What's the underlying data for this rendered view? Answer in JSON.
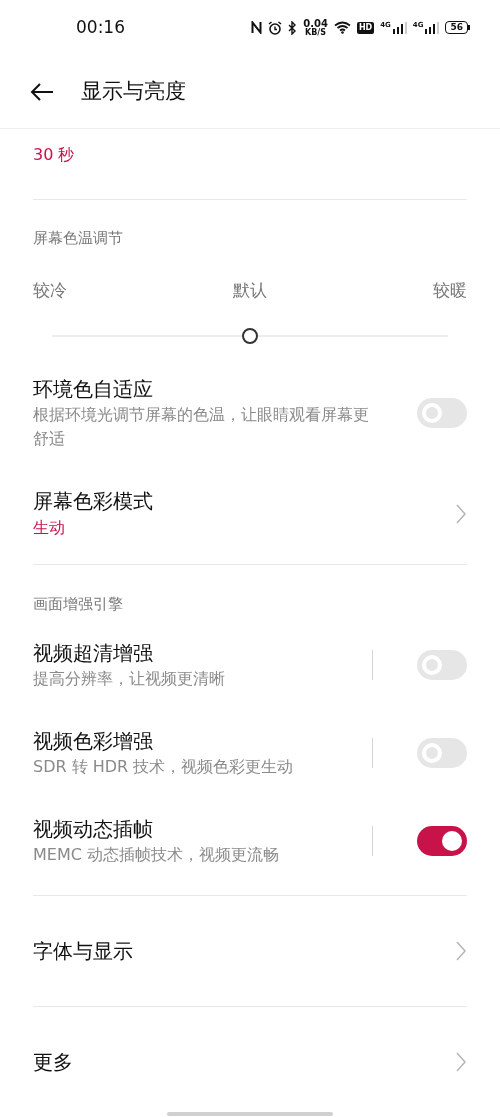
{
  "status_bar": {
    "time": "00:16",
    "speed_value": "0.04",
    "speed_unit": "KB/S",
    "hd": "HD",
    "networks": [
      "4G",
      "4G"
    ],
    "battery": "56"
  },
  "header": {
    "title": "显示与亮度"
  },
  "screen_off": {
    "value": "30 秒"
  },
  "color_temperature": {
    "heading": "屏幕色温调节",
    "labels": [
      "较冷",
      "默认",
      "较暖"
    ],
    "level": 0.5
  },
  "items": [
    {
      "kind": "switch",
      "title": "环境色自适应",
      "subtitle": "根据环境光调节屏幕的色温，让眼睛观看屏幕更舒适",
      "on": false,
      "divider": false
    },
    {
      "kind": "link",
      "title": "屏幕色彩模式",
      "value": "生动"
    }
  ],
  "enhance": {
    "heading": "画面增强引擎",
    "items": [
      {
        "kind": "switch",
        "title": "视频超清增强",
        "subtitle": "提高分辨率，让视频更清晰",
        "on": false,
        "divider": true
      },
      {
        "kind": "switch",
        "title": "视频色彩增强",
        "subtitle": "SDR 转 HDR 技术，视频色彩更生动",
        "on": false,
        "divider": true
      },
      {
        "kind": "switch",
        "title": "视频动态插帧",
        "subtitle": "MEMC 动态插帧技术，视频更流畅",
        "on": true,
        "divider": true
      }
    ]
  },
  "links": [
    {
      "title": "字体与显示"
    },
    {
      "title": "更多"
    }
  ]
}
